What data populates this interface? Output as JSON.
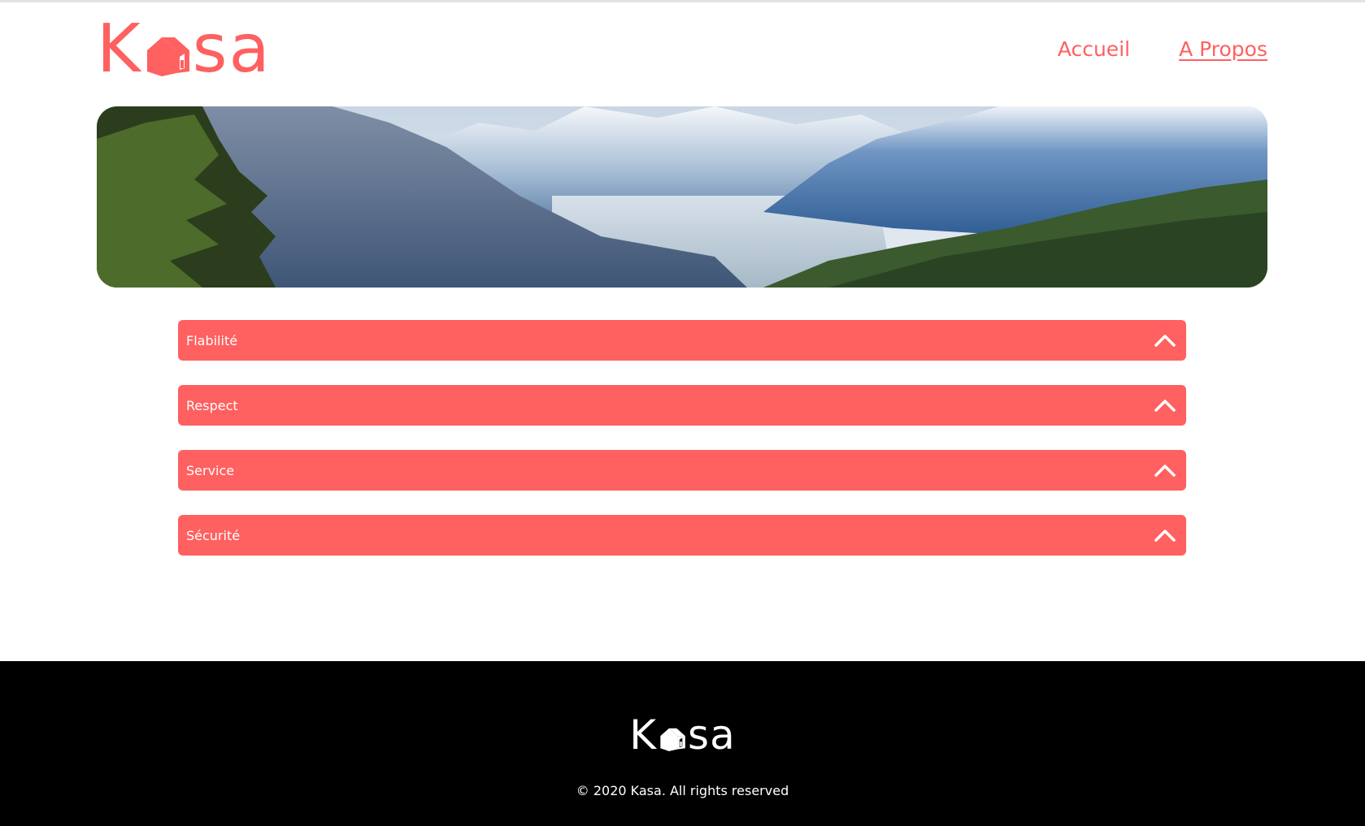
{
  "brand": {
    "letters_left": "K",
    "letters_right": "sa",
    "name": "Kasa",
    "accent_color": "#ff6060"
  },
  "nav": {
    "items": [
      {
        "label": "Accueil",
        "active": false
      },
      {
        "label": "A Propos",
        "active": true
      }
    ]
  },
  "banner": {
    "icon": "mountain-landscape-image"
  },
  "collapses": [
    {
      "title": "Flabilité",
      "icon": "chevron-up-icon"
    },
    {
      "title": "Respect",
      "icon": "chevron-up-icon"
    },
    {
      "title": "Service",
      "icon": "chevron-up-icon"
    },
    {
      "title": "Sécurité",
      "icon": "chevron-up-icon"
    }
  ],
  "footer": {
    "copyright": "© 2020 Kasa. All rights reserved",
    "background": "#000000"
  }
}
